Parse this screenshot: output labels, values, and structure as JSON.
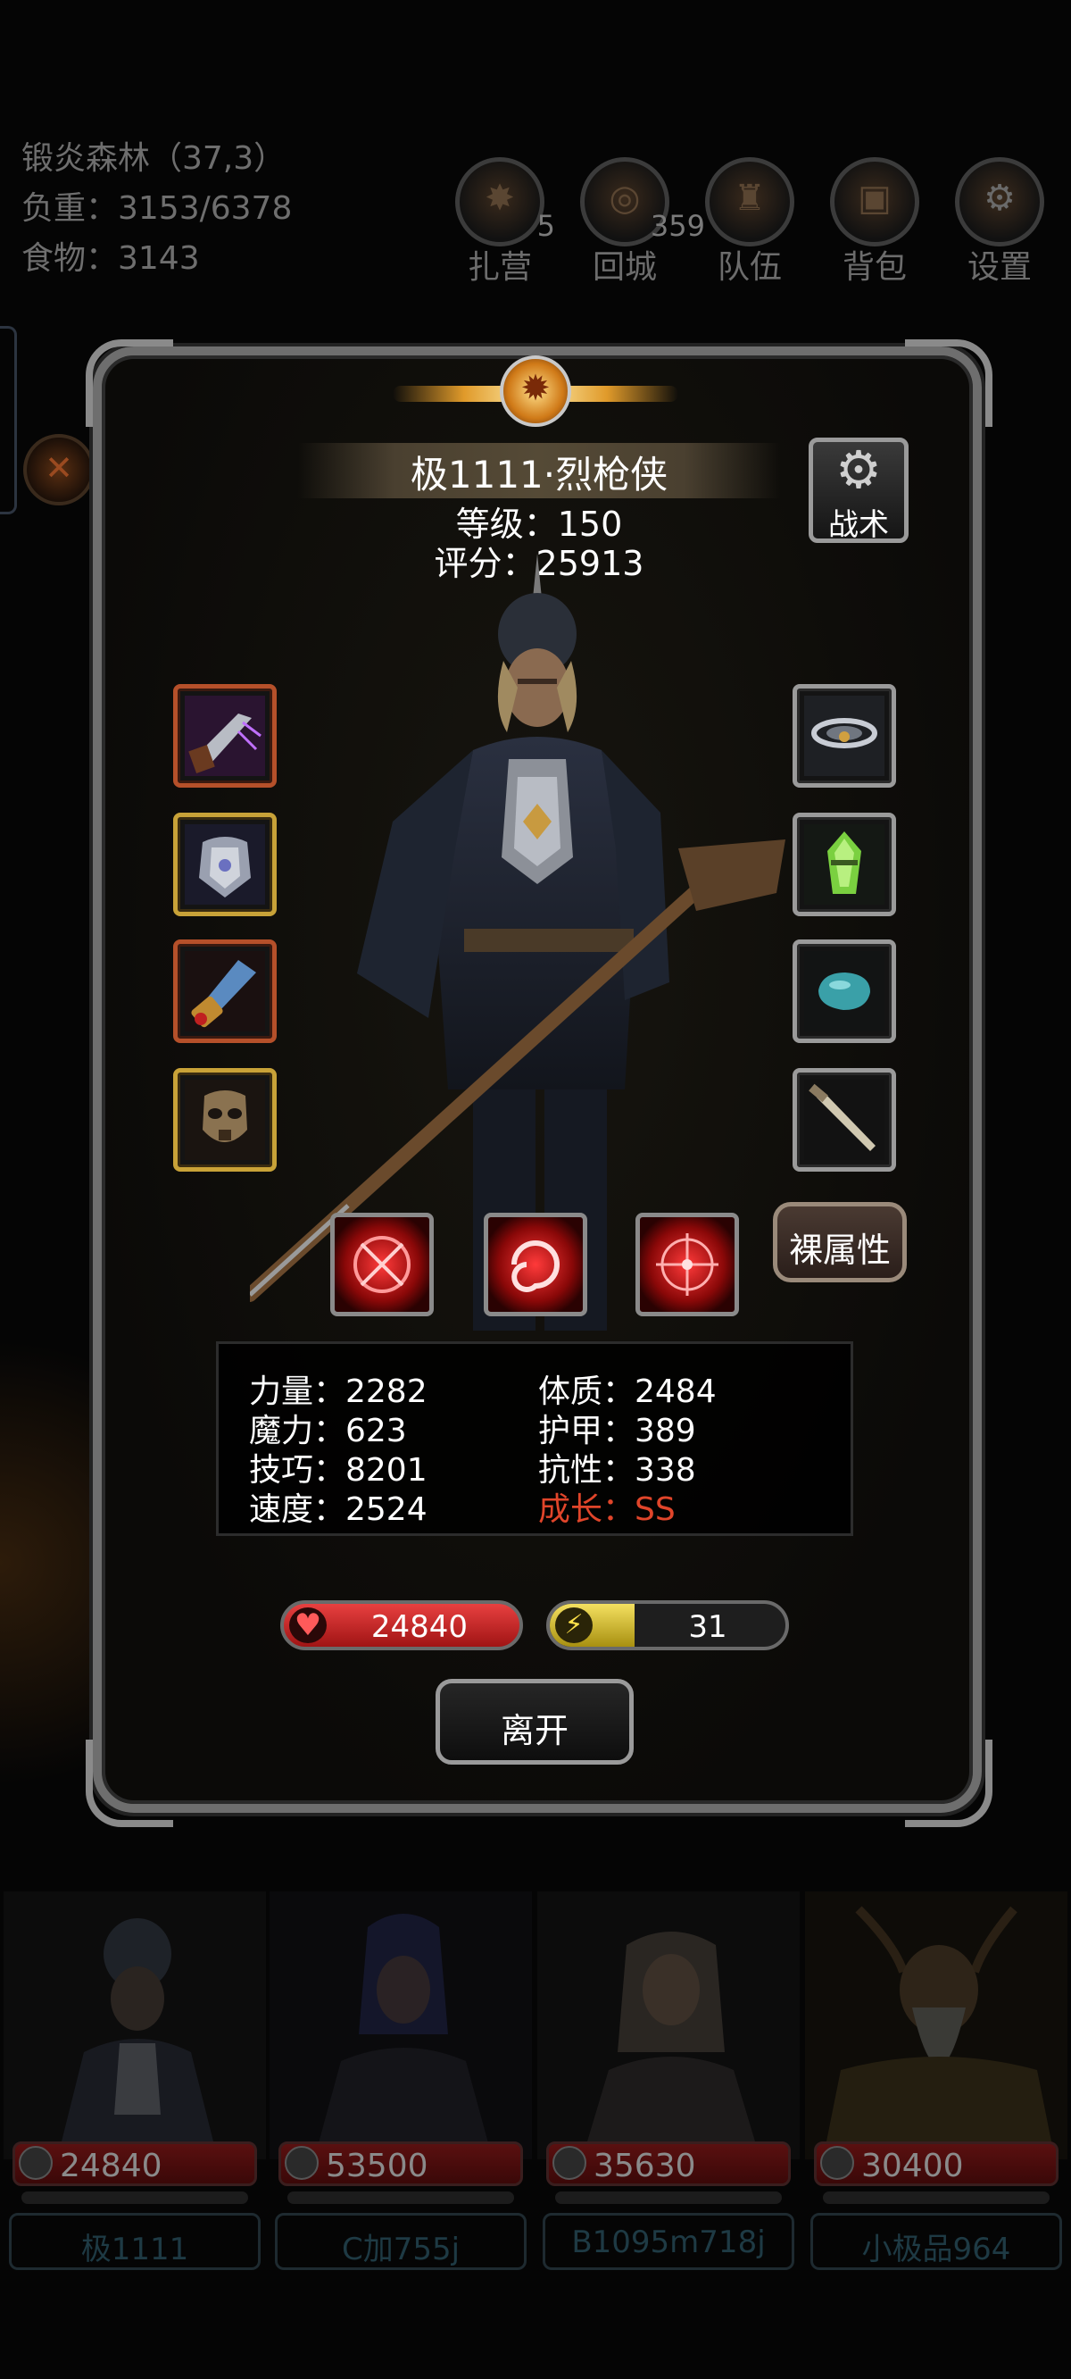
{
  "hud": {
    "location": "锻炎森林（37,3）",
    "weight": "负重：3153/6378",
    "food": "食物：3143",
    "buttons": [
      {
        "label": "扎营",
        "badge": "5",
        "icon": "campfire-icon"
      },
      {
        "label": "回城",
        "badge": "359",
        "icon": "portal-icon"
      },
      {
        "label": "队伍",
        "badge": "",
        "icon": "team-icon"
      },
      {
        "label": "背包",
        "badge": "",
        "icon": "backpack-icon"
      },
      {
        "label": "设置",
        "badge": "",
        "icon": "gear-icon"
      }
    ]
  },
  "character": {
    "name": "极1111·烈枪侠",
    "level": "等级：150",
    "score": "评分：25913",
    "tactics_label": "战术",
    "naked_stats_label": "裸属性",
    "stats": [
      {
        "label": "力量：2282"
      },
      {
        "label": "体质：2484"
      },
      {
        "label": "魔力：623"
      },
      {
        "label": "护甲：389"
      },
      {
        "label": "技巧：8201"
      },
      {
        "label": "抗性：338"
      },
      {
        "label": "速度：2524"
      },
      {
        "label": "成长：SS"
      }
    ],
    "hp": "24840",
    "energy": "31",
    "energy_fill": 0.36,
    "leave_label": "离开",
    "equipment_left": [
      "flintlock-pistol-icon",
      "chest-armor-icon",
      "bracer-icon",
      "mask-icon"
    ],
    "equipment_right": [
      "cloud-ring-icon",
      "green-gem-icon",
      "teal-stone-icon",
      "bone-blade-icon"
    ],
    "skills": [
      "crosshair-skill-icon",
      "swirl-skill-icon",
      "target-skill-icon"
    ]
  },
  "team": [
    {
      "hp": "24840",
      "name": "极1111"
    },
    {
      "hp": "53500",
      "name": "C加755j"
    },
    {
      "hp": "35630",
      "name": "B1095m718j"
    },
    {
      "hp": "30400",
      "name": "小极品964"
    }
  ],
  "colors": {
    "growth": "#e0452a",
    "hp": "#d02020",
    "energy": "#e8d040"
  }
}
